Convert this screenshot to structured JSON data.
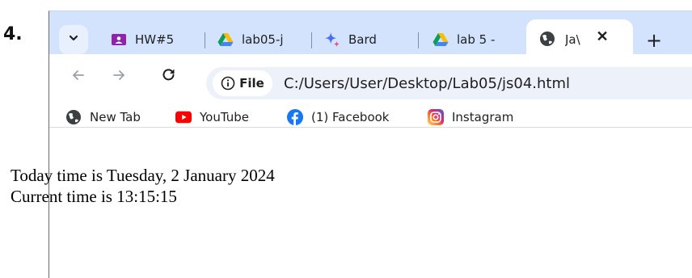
{
  "step_number": "4.",
  "tabs": [
    {
      "label": "HW#5",
      "icon": "google-classroom-icon"
    },
    {
      "label": "lab05-j",
      "icon": "google-drive-icon"
    },
    {
      "label": "Bard",
      "icon": "bard-sparkle-icon"
    },
    {
      "label": "lab 5 -",
      "icon": "google-drive-icon"
    }
  ],
  "active_tab": {
    "label": "Ja\\",
    "icon": "globe-icon",
    "close": "✕"
  },
  "new_tab": "+",
  "omnibox": {
    "chip": "File",
    "url": "C:/Users/User/Desktop/Lab05/js04.html"
  },
  "bookmarks": [
    {
      "label": "New Tab",
      "icon": "globe-icon"
    },
    {
      "label": "YouTube",
      "icon": "youtube-icon"
    },
    {
      "label": "(1) Facebook",
      "icon": "facebook-icon"
    },
    {
      "label": "Instagram",
      "icon": "instagram-icon"
    }
  ],
  "page": {
    "line1": "Today time is Tuesday, 2 January 2024",
    "line2": "Current time is 13:15:15"
  },
  "colors": {
    "tab_strip": "#d3e3fd",
    "omnibox": "#edf2fa",
    "classroom": "#8e24aa",
    "youtube": "#ff0000",
    "facebook": "#1877f2"
  }
}
